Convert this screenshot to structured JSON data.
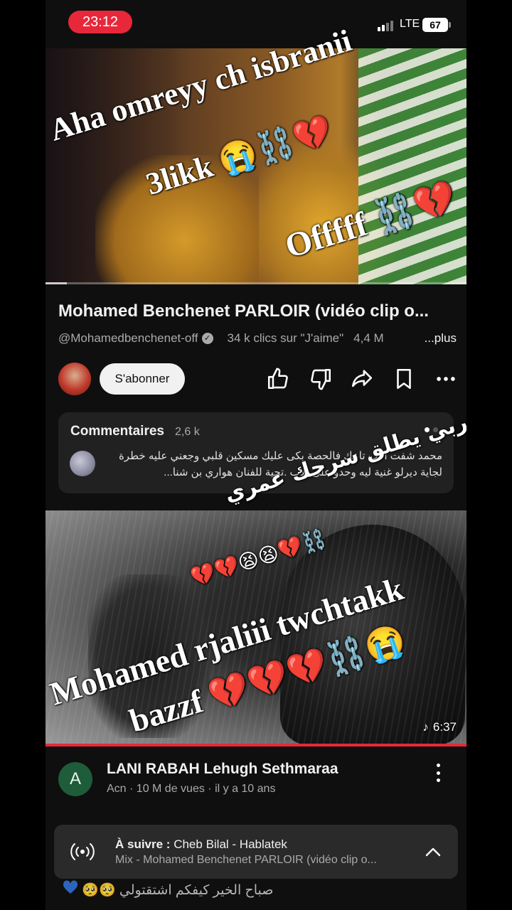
{
  "status_bar": {
    "time": "23:12",
    "network": "LTE",
    "battery": "67"
  },
  "top_video": {
    "overlay_text": {
      "line1": "Aha omreyy ch isbranii",
      "line2": "3likk 😭⛓️💔",
      "line3": "Offfff ⛓️💔"
    },
    "progress_fraction": 0.05
  },
  "video_info": {
    "title": "Mohamed Benchenet PARLOIR (vidéo clip o...",
    "channel_handle": "@Mohamedbenchenet-off",
    "likes_text": "34 k clics sur \"J'aime\"",
    "views_partial": "4,4 M",
    "more_label": "...plus",
    "subscribe_label": "S'abonner"
  },
  "actions": [
    {
      "name": "like-icon"
    },
    {
      "name": "dislike-icon"
    },
    {
      "name": "share-icon"
    },
    {
      "name": "save-icon"
    },
    {
      "name": "more-icon"
    }
  ],
  "comments": {
    "title": "Commentaires",
    "count": "2,6 k",
    "top_comment": "محمد شفت الاب تاعك  فالحصة بكى عليك مسكين قلبي وجعني عليه خطرة لجاية ديرلو غنية ليه وحدو على الاب .تحية للفنان هواري بن شنا..."
  },
  "second_video": {
    "overlay_text": {
      "arabic_line1": "ربي يطلق سرحك عمري",
      "arabic_line2": "⛓️💔😫😫💔💔",
      "latin_line1": "Mohamed rjaliii twchtakk",
      "latin_line2": "bazzf 💔💔💔⛓️😭"
    },
    "duration": "6:37",
    "channel_initial": "A",
    "title": "LANI RABAH Lehugh Sethmaraa",
    "meta": "Acn · 10 M de vues · il y a 10 ans"
  },
  "up_next": {
    "prefix": "À suivre : ",
    "next_title": "Cheb Bilal - Hablatek",
    "mix_title": "Mix - Mohamed Benchenet PARLOIR (vidéo clip o..."
  },
  "bottom_overlay_text": "صباح الخير كيفكم اشتقتولي 🥺🥺"
}
